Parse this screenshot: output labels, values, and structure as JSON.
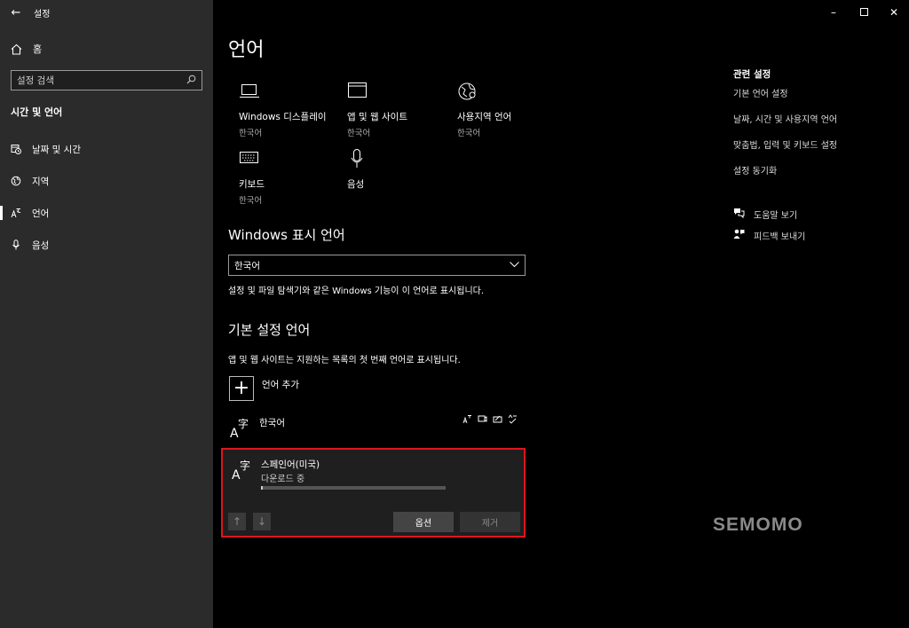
{
  "window": {
    "app_title": "설정"
  },
  "sidebar": {
    "home_label": "홈",
    "search_placeholder": "설정 검색",
    "section_title": "시간 및 언어",
    "items": [
      {
        "label": "날짜 및 시간",
        "icon": "calendar-clock-icon"
      },
      {
        "label": "지역",
        "icon": "globe-icon"
      },
      {
        "label": "언어",
        "icon": "language-icon",
        "active": true
      },
      {
        "label": "음성",
        "icon": "microphone-icon"
      }
    ]
  },
  "main": {
    "title": "언어",
    "tiles": [
      {
        "title": "Windows 디스플레이",
        "sub": "한국어",
        "icon": "laptop-icon"
      },
      {
        "title": "앱 및 웹 사이트",
        "sub": "한국어",
        "icon": "window-icon"
      },
      {
        "title": "사용지역 언어",
        "sub": "한국어",
        "icon": "globe-icon"
      },
      {
        "title": "키보드",
        "sub": "한국어",
        "icon": "keyboard-icon"
      },
      {
        "title": "음성",
        "sub": "",
        "icon": "microphone-icon"
      }
    ],
    "display_language": {
      "heading": "Windows 표시 언어",
      "selected": "한국어",
      "description": "설정 및 파일 탐색기와 같은 Windows 기능이 이 언어로 표시됩니다."
    },
    "preferred": {
      "heading": "기본 설정 언어",
      "description": "앱 및 웹 사이트는 지원하는 목록의 첫 번째 언어로 표시됩니다.",
      "add_label": "언어 추가",
      "languages": [
        {
          "name": "한국어"
        },
        {
          "name": "스페인어(미국)",
          "status": "다운로드 중",
          "progress": 0.01
        }
      ],
      "options_label": "옵션",
      "remove_label": "제거"
    }
  },
  "related": {
    "title": "관련 설정",
    "links": [
      "기본 언어 설정",
      "날짜, 시간 및 사용지역 언어",
      "맞춤법, 입력 및 키보드 설정",
      "설정 동기화"
    ],
    "help": [
      {
        "label": "도움말 보기",
        "icon": "help-chat-icon"
      },
      {
        "label": "피드백 보내기",
        "icon": "feedback-icon"
      }
    ]
  },
  "watermark": "SEMOMO"
}
